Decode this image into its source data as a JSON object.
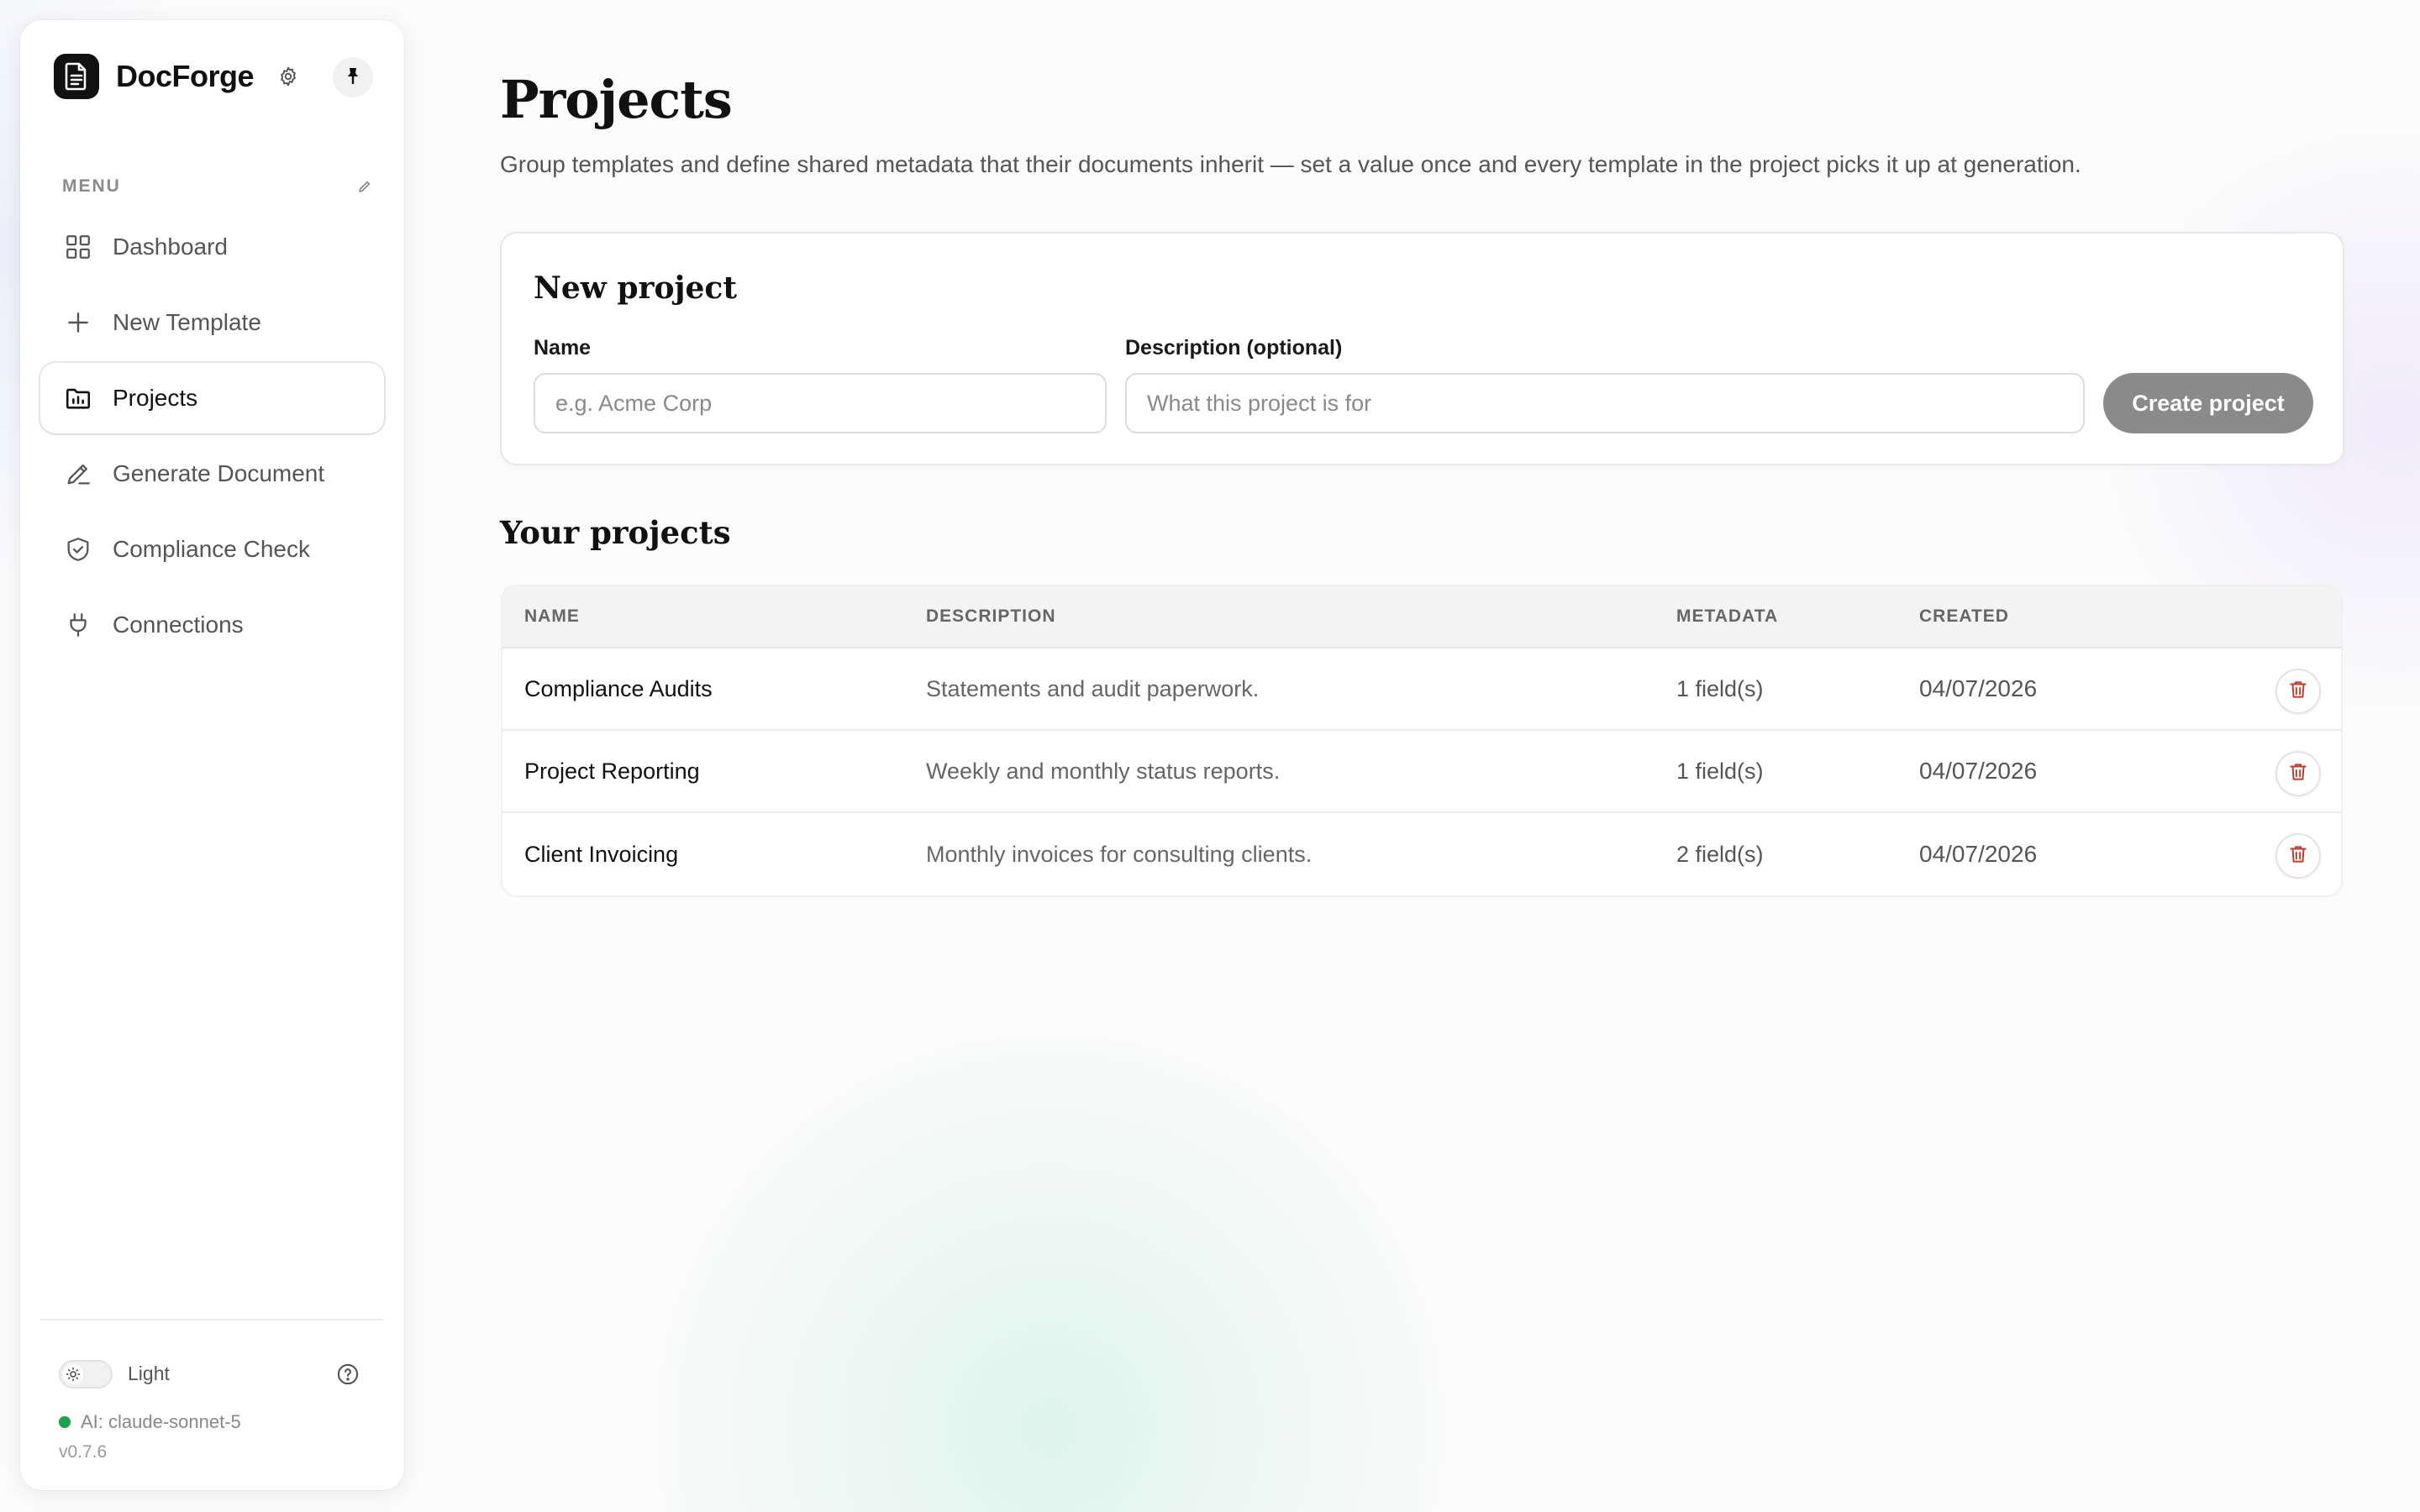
{
  "sidebar": {
    "brand": "DocForge",
    "menu_label": "MENU",
    "items": [
      {
        "label": "Dashboard",
        "icon": "dashboard-grid-icon",
        "active": false
      },
      {
        "label": "New Template",
        "icon": "plus-icon",
        "active": false
      },
      {
        "label": "Projects",
        "icon": "folder-chart-icon",
        "active": true
      },
      {
        "label": "Generate Document",
        "icon": "pen-icon",
        "active": false
      },
      {
        "label": "Compliance Check",
        "icon": "shield-check-icon",
        "active": false
      },
      {
        "label": "Connections",
        "icon": "plug-icon",
        "active": false
      }
    ],
    "theme_label": "Light",
    "ai_status": "AI: claude-sonnet-5",
    "ai_status_color": "#17a34a",
    "version": "v0.7.6"
  },
  "page": {
    "title": "Projects",
    "subtitle": "Group templates and define shared metadata that their documents inherit — set a value once and every template in the project picks it up at generation."
  },
  "new_project": {
    "title": "New project",
    "name_label": "Name",
    "name_placeholder": "e.g. Acme Corp",
    "name_value": "",
    "description_label": "Description (optional)",
    "description_placeholder": "What this project is for",
    "description_value": "",
    "create_label": "Create project"
  },
  "projects": {
    "title": "Your projects",
    "columns": {
      "name": "NAME",
      "description": "DESCRIPTION",
      "metadata": "METADATA",
      "created": "CREATED"
    },
    "rows": [
      {
        "name": "Compliance Audits",
        "description": "Statements and audit paperwork.",
        "metadata": "1 field(s)",
        "created": "04/07/2026"
      },
      {
        "name": "Project Reporting",
        "description": "Weekly and monthly status reports.",
        "metadata": "1 field(s)",
        "created": "04/07/2026"
      },
      {
        "name": "Client Invoicing",
        "description": "Monthly invoices for consulting clients.",
        "metadata": "2 field(s)",
        "created": "04/07/2026"
      }
    ]
  },
  "colors": {
    "accent_dark": "#111111",
    "delete_red": "#c0392b",
    "button_disabled": "#8a8a8a"
  }
}
